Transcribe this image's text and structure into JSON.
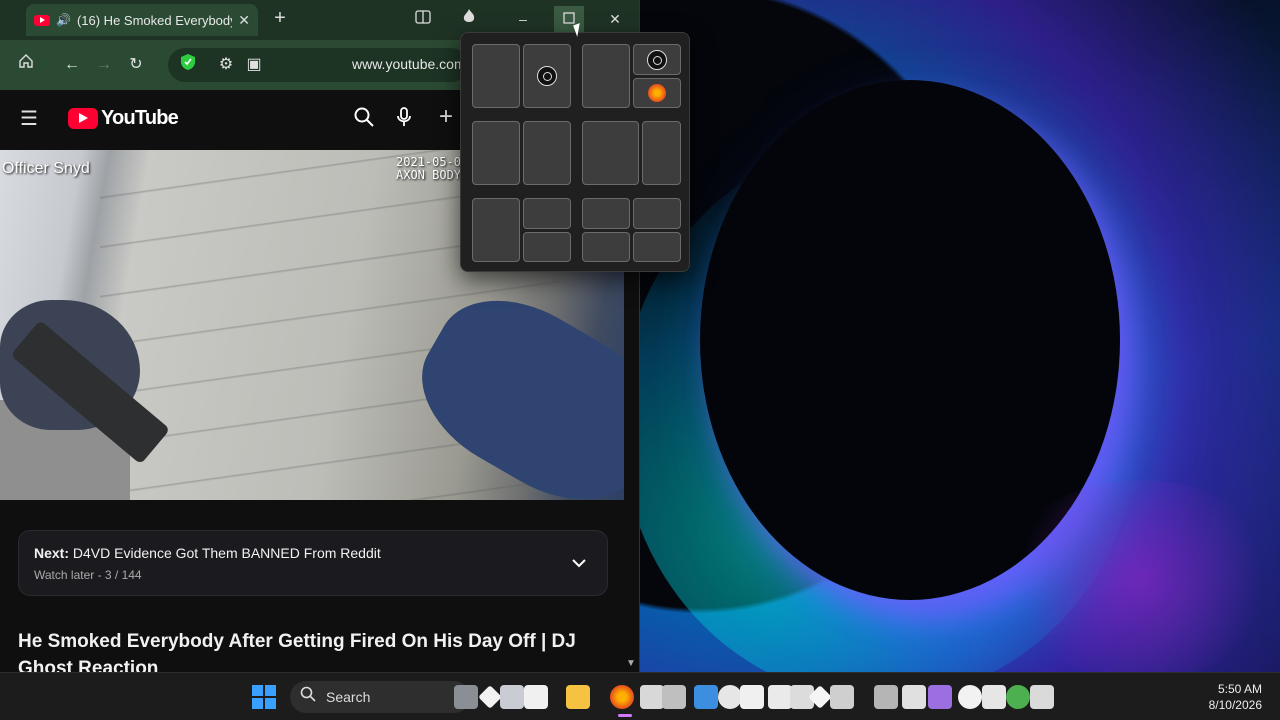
{
  "browser": {
    "tab": {
      "title": "(16) He Smoked Everybody",
      "audio_icon": "speaker-icon"
    },
    "url": "www.youtube.com",
    "tab_close_label": "✕",
    "new_tab_label": "+"
  },
  "youtube": {
    "logo_text": "YouTube",
    "video_overlay_left": "Officer Snyd",
    "video_overlay_right_1": "2021-05-0",
    "video_overlay_right_2": "AXON BODY",
    "next_prefix": "Next:",
    "next_title": "D4VD Evidence Got Them BANNED From Reddit",
    "next_sub": "Watch later - 3 / 144",
    "video_title": "He Smoked Everybody After Getting Fired On His Day Off | DJ Ghost Reaction"
  },
  "colors": {
    "chrome_bg": "#2b4a33",
    "youtube_red": "#ff0033",
    "snap_bg": "#202020"
  },
  "taskbar": {
    "search_label": "Search",
    "time": "5:50 AM",
    "date": "8/10/2026"
  }
}
